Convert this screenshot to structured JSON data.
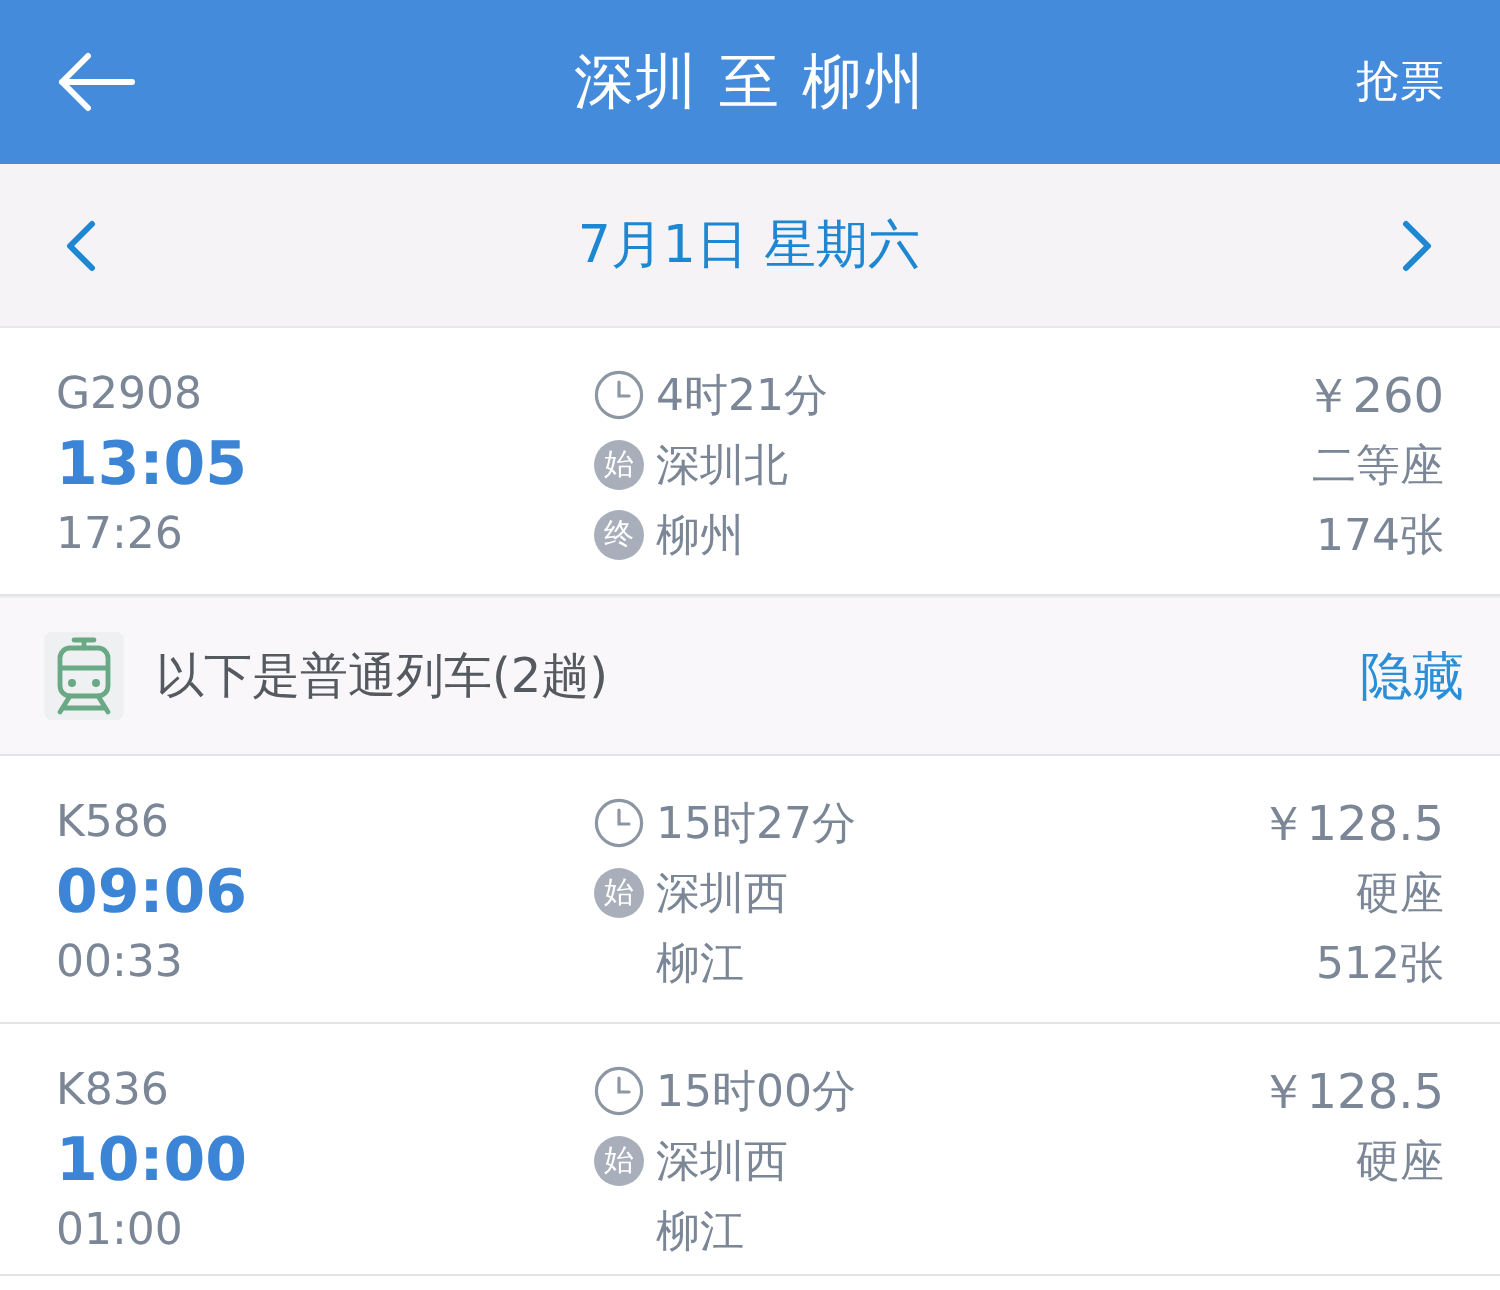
{
  "header": {
    "title": "深圳 至 柳州",
    "action": "抢票"
  },
  "date_bar": {
    "date": "7月1日 星期六"
  },
  "high_speed_trains": [
    {
      "number": "G2908",
      "depart_time": "13:05",
      "arrive_time": "17:26",
      "duration": "4时21分",
      "from": {
        "badge": "始",
        "station": "深圳北"
      },
      "to": {
        "badge": "终",
        "station": "柳州"
      },
      "price": "￥260",
      "seat": "二等座",
      "tickets": "174张"
    }
  ],
  "regular_trains": {
    "label": "以下是普通列车(2趟)",
    "toggle": "隐藏",
    "trains": [
      {
        "number": "K586",
        "depart_time": "09:06",
        "arrive_time": "00:33",
        "duration": "15时27分",
        "from": {
          "badge": "始",
          "station": "深圳西"
        },
        "to": {
          "station": "柳江"
        },
        "price": "￥128.5",
        "seat": "硬座",
        "tickets": "512张"
      },
      {
        "number": "K836",
        "depart_time": "10:00",
        "arrive_time": "01:00",
        "duration": "15时00分",
        "from": {
          "badge": "始",
          "station": "深圳西"
        },
        "to": {
          "station": "柳江"
        },
        "price": "￥128.5",
        "seat": "硬座"
      }
    ]
  }
}
